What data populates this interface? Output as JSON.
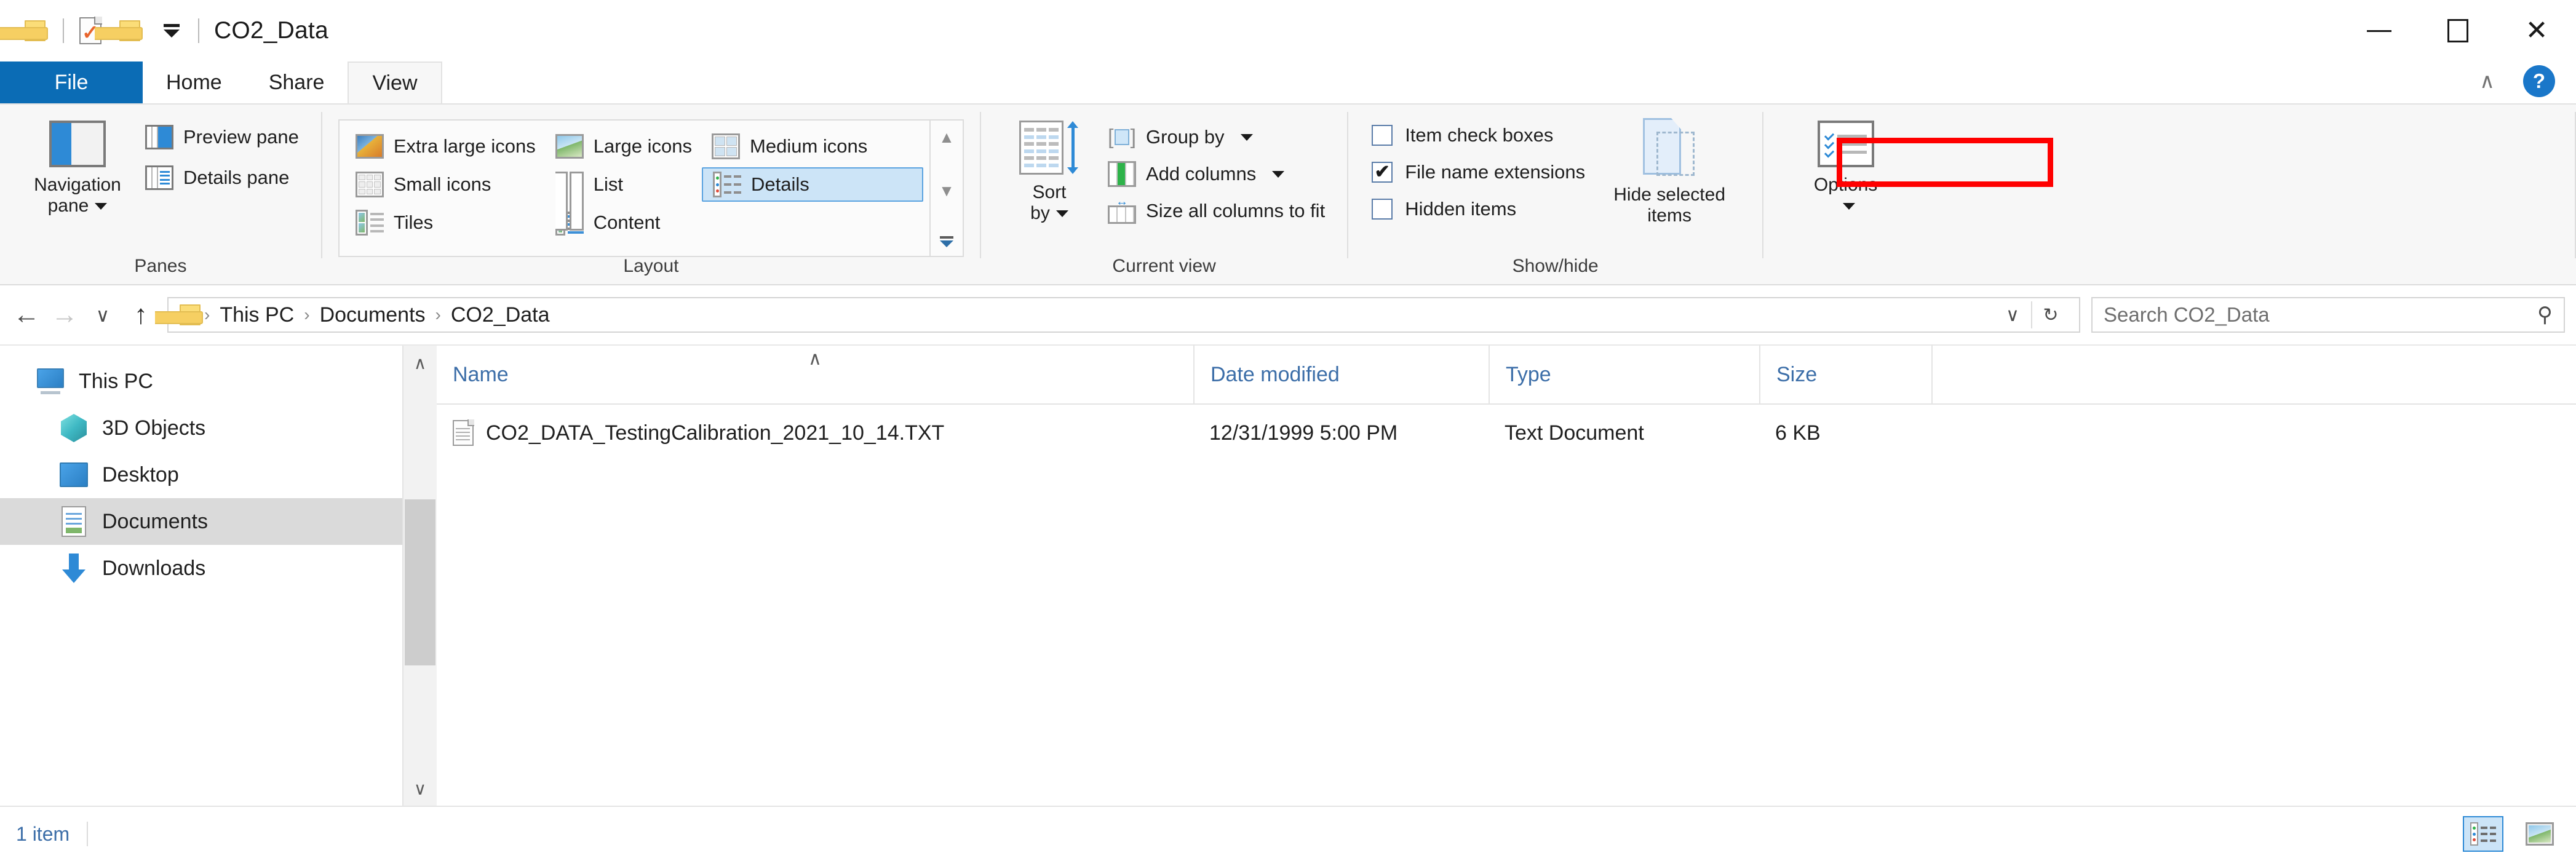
{
  "window": {
    "title": "CO2_Data",
    "quick_access": [
      {
        "name": "folder-icon",
        "label": "Folder"
      },
      {
        "name": "properties-icon",
        "label": "Properties"
      },
      {
        "name": "new-folder-icon",
        "label": "New folder"
      },
      {
        "name": "customize-dropdown",
        "label": "Customize Quick Access Toolbar"
      }
    ],
    "controls": {
      "minimize": "—",
      "maximize": "□",
      "close": "✕"
    }
  },
  "ribbon": {
    "tabs": [
      {
        "label": "File",
        "state": "file"
      },
      {
        "label": "Home",
        "state": "normal"
      },
      {
        "label": "Share",
        "state": "normal"
      },
      {
        "label": "View",
        "state": "active"
      }
    ],
    "collapse_icon": "∧",
    "help_label": "?",
    "groups": {
      "panes": {
        "label": "Panes",
        "navigation_pane": "Navigation\npane",
        "navigation_pane_line1": "Navigation",
        "navigation_pane_line2": "pane",
        "preview_pane": "Preview pane",
        "details_pane": "Details pane"
      },
      "layout": {
        "label": "Layout",
        "items": [
          {
            "label": "Extra large icons",
            "selected": false
          },
          {
            "label": "Large icons",
            "selected": false
          },
          {
            "label": "Medium icons",
            "selected": false
          },
          {
            "label": "Small icons",
            "selected": false
          },
          {
            "label": "List",
            "selected": false
          },
          {
            "label": "Details",
            "selected": true
          },
          {
            "label": "Tiles",
            "selected": false
          },
          {
            "label": "Content",
            "selected": false
          }
        ],
        "scroll_up": "▲",
        "scroll_down": "▼"
      },
      "current_view": {
        "label": "Current view",
        "sort_by_line1": "Sort",
        "sort_by_line2": "by",
        "group_by": "Group by",
        "add_columns": "Add columns",
        "size_all_columns": "Size all columns to fit"
      },
      "show_hide": {
        "label": "Show/hide",
        "item_check_boxes": {
          "label": "Item check boxes",
          "checked": false
        },
        "file_name_extensions": {
          "label": "File name extensions",
          "checked": true,
          "mark": "✔"
        },
        "hidden_items": {
          "label": "Hidden items",
          "checked": false
        },
        "hide_selected_line1": "Hide selected",
        "hide_selected_line2": "items"
      },
      "options": {
        "label": "Options"
      }
    }
  },
  "annotation": {
    "color": "#ff0000",
    "target": "file-name-extensions-checkbox"
  },
  "address_bar": {
    "back_icon": "←",
    "forward_icon": "→",
    "recent_icon": "∨",
    "up_icon": "↑",
    "breadcrumbs": [
      "This PC",
      "Documents",
      "CO2_Data"
    ],
    "separator": "›",
    "dropdown_icon": "∨",
    "refresh_icon": "↻",
    "search_placeholder": "Search CO2_Data",
    "search_value": "",
    "search_icon": "⚲"
  },
  "sidebar": {
    "items": [
      {
        "label": "This PC",
        "icon": "pc-icon",
        "selected": false,
        "root": true
      },
      {
        "label": "3D Objects",
        "icon": "3d-objects-icon",
        "selected": false,
        "root": false
      },
      {
        "label": "Desktop",
        "icon": "desktop-icon",
        "selected": false,
        "root": false
      },
      {
        "label": "Documents",
        "icon": "documents-icon",
        "selected": true,
        "root": false
      },
      {
        "label": "Downloads",
        "icon": "downloads-icon",
        "selected": false,
        "root": false
      }
    ],
    "scroll_up": "∧",
    "scroll_down": "∨"
  },
  "file_list": {
    "columns": [
      {
        "label": "Name",
        "sorted": true,
        "sort_icon": "∧"
      },
      {
        "label": "Date modified",
        "sorted": false
      },
      {
        "label": "Type",
        "sorted": false
      },
      {
        "label": "Size",
        "sorted": false
      }
    ],
    "rows": [
      {
        "name": "CO2_DATA_TestingCalibration_2021_10_14.TXT",
        "date_modified": "12/31/1999 5:00 PM",
        "type": "Text Document",
        "size": "6 KB",
        "icon": "text-file-icon"
      }
    ]
  },
  "status_bar": {
    "item_count": "1 item",
    "view_details_label": "Details view",
    "view_large_icons_label": "Large icons view",
    "selected_view": "details"
  }
}
